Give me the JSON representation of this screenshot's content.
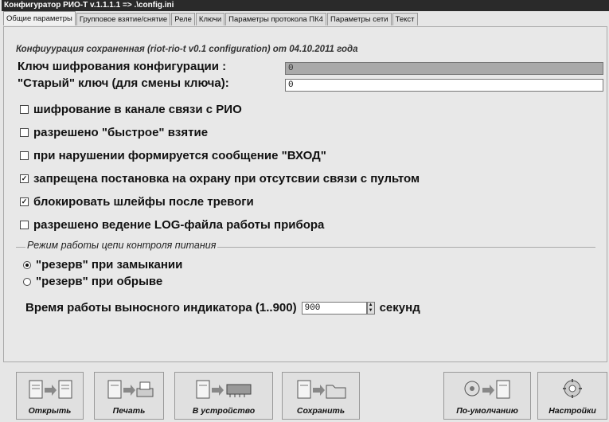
{
  "window": {
    "title": "Конфигуратор РИО-Т v.1.1.1.1   =>  .\\config.ini"
  },
  "tabs": [
    {
      "label": "Общие параметры",
      "active": true
    },
    {
      "label": "Групповое взятие/снятие"
    },
    {
      "label": "Реле"
    },
    {
      "label": "Ключи"
    },
    {
      "label": "Параметры протокола ПК4"
    },
    {
      "label": "Параметры сети"
    },
    {
      "label": "Текст"
    }
  ],
  "config_saved": "Конфиуурация сохраненная (riot-rio-t v0.1 configuration) от 04.10.2011 года",
  "encryption_key": {
    "label": "Ключ шифрования конфигурации :",
    "value": "0"
  },
  "old_key": {
    "label": "\"Старый\" ключ (для смены ключа):",
    "value": "0"
  },
  "options": [
    {
      "label": "шифрование  в канале связи с РИО",
      "checked": false
    },
    {
      "label": "разрешено \"быстрое\" взятие",
      "checked": false
    },
    {
      "label": "при нарушении формируется сообщение \"ВХОД\"",
      "checked": false
    },
    {
      "label": "запрещена постановка на охрану при отсутсвии связи с пультом",
      "checked": true
    },
    {
      "label": "блокировать шлейфы после тревоги",
      "checked": true
    },
    {
      "label": "разрешено ведение LOG-файла работы прибора",
      "checked": false
    }
  ],
  "power_mode": {
    "title": "Режим работы цепи контроля питания",
    "options": [
      {
        "label": "\"резерв\" при замыкании",
        "selected": true
      },
      {
        "label": "\"резерв\" при обрыве",
        "selected": false
      }
    ]
  },
  "indicator_time": {
    "label": "Время работы выносного индикатора  (1..900)",
    "value": "900",
    "unit": "секунд"
  },
  "toolbar": [
    {
      "label": "Открыть",
      "icon": "open-icon"
    },
    {
      "label": "Печать",
      "icon": "print-icon"
    },
    {
      "label": "В устройство",
      "icon": "upload-to-device-icon"
    },
    {
      "label": "Сохранить",
      "icon": "save-icon"
    },
    {
      "label": "По-умолчанию",
      "icon": "defaults-icon"
    },
    {
      "label": "Настройки",
      "icon": "settings-icon"
    }
  ]
}
